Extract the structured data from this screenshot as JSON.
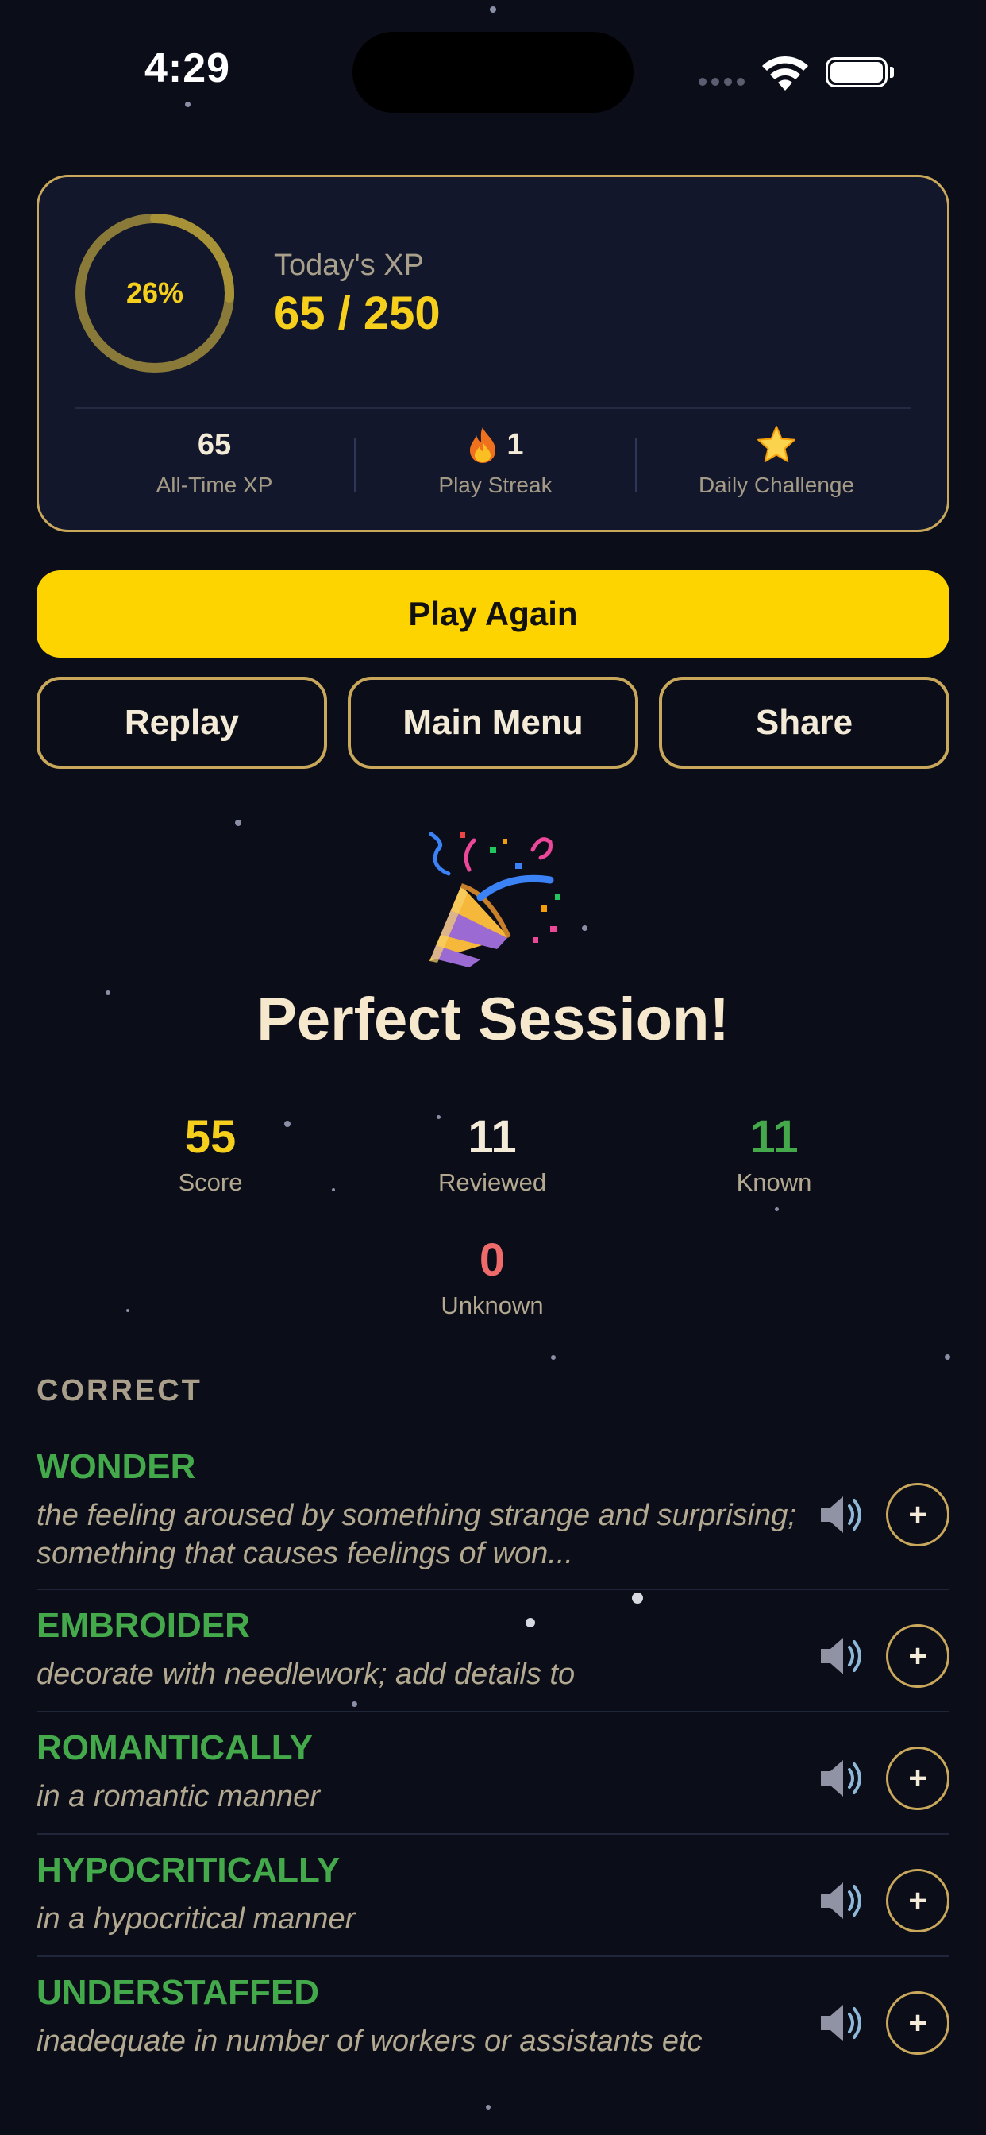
{
  "status_bar": {
    "time": "4:29"
  },
  "xp_card": {
    "progress_percent_label": "26%",
    "progress_fraction": 0.26,
    "title": "Today's XP",
    "value": "65 / 250",
    "stats": [
      {
        "value": "65",
        "label": "All-Time XP",
        "icon": ""
      },
      {
        "value": "1",
        "label": "Play Streak",
        "icon": "fire-icon"
      },
      {
        "value": "",
        "label": "Daily Challenge",
        "icon": "star-icon"
      }
    ]
  },
  "buttons": {
    "play_again": "Play Again",
    "replay": "Replay",
    "main_menu": "Main Menu",
    "share": "Share"
  },
  "session": {
    "icon": "party-popper-icon",
    "title": "Perfect Session!",
    "stats": {
      "score": {
        "value": "55",
        "label": "Score",
        "color": "#f5cf1b"
      },
      "reviewed": {
        "value": "11",
        "label": "Reviewed",
        "color": "#f3ead7"
      },
      "known": {
        "value": "11",
        "label": "Known",
        "color": "#43a94b"
      },
      "unknown": {
        "value": "0",
        "label": "Unknown",
        "color": "#ef6a6a"
      }
    }
  },
  "correct_section": {
    "label": "CORRECT",
    "words": [
      {
        "word": "WONDER",
        "definition": "the feeling aroused by something strange and surprising; something that causes feelings of won..."
      },
      {
        "word": "EMBROIDER",
        "definition": "decorate with needlework; add details to"
      },
      {
        "word": "ROMANTICALLY",
        "definition": "in a romantic manner"
      },
      {
        "word": "HYPOCRITICALLY",
        "definition": "in a hypocritical manner"
      },
      {
        "word": "UNDERSTAFFED",
        "definition": "inadequate in number of workers or assistants etc"
      }
    ],
    "add_label": "+"
  },
  "colors": {
    "accent": "#fdd400",
    "border_gold": "#c9a85c",
    "correct_green": "#43a94b",
    "background": "#0b0d19"
  }
}
